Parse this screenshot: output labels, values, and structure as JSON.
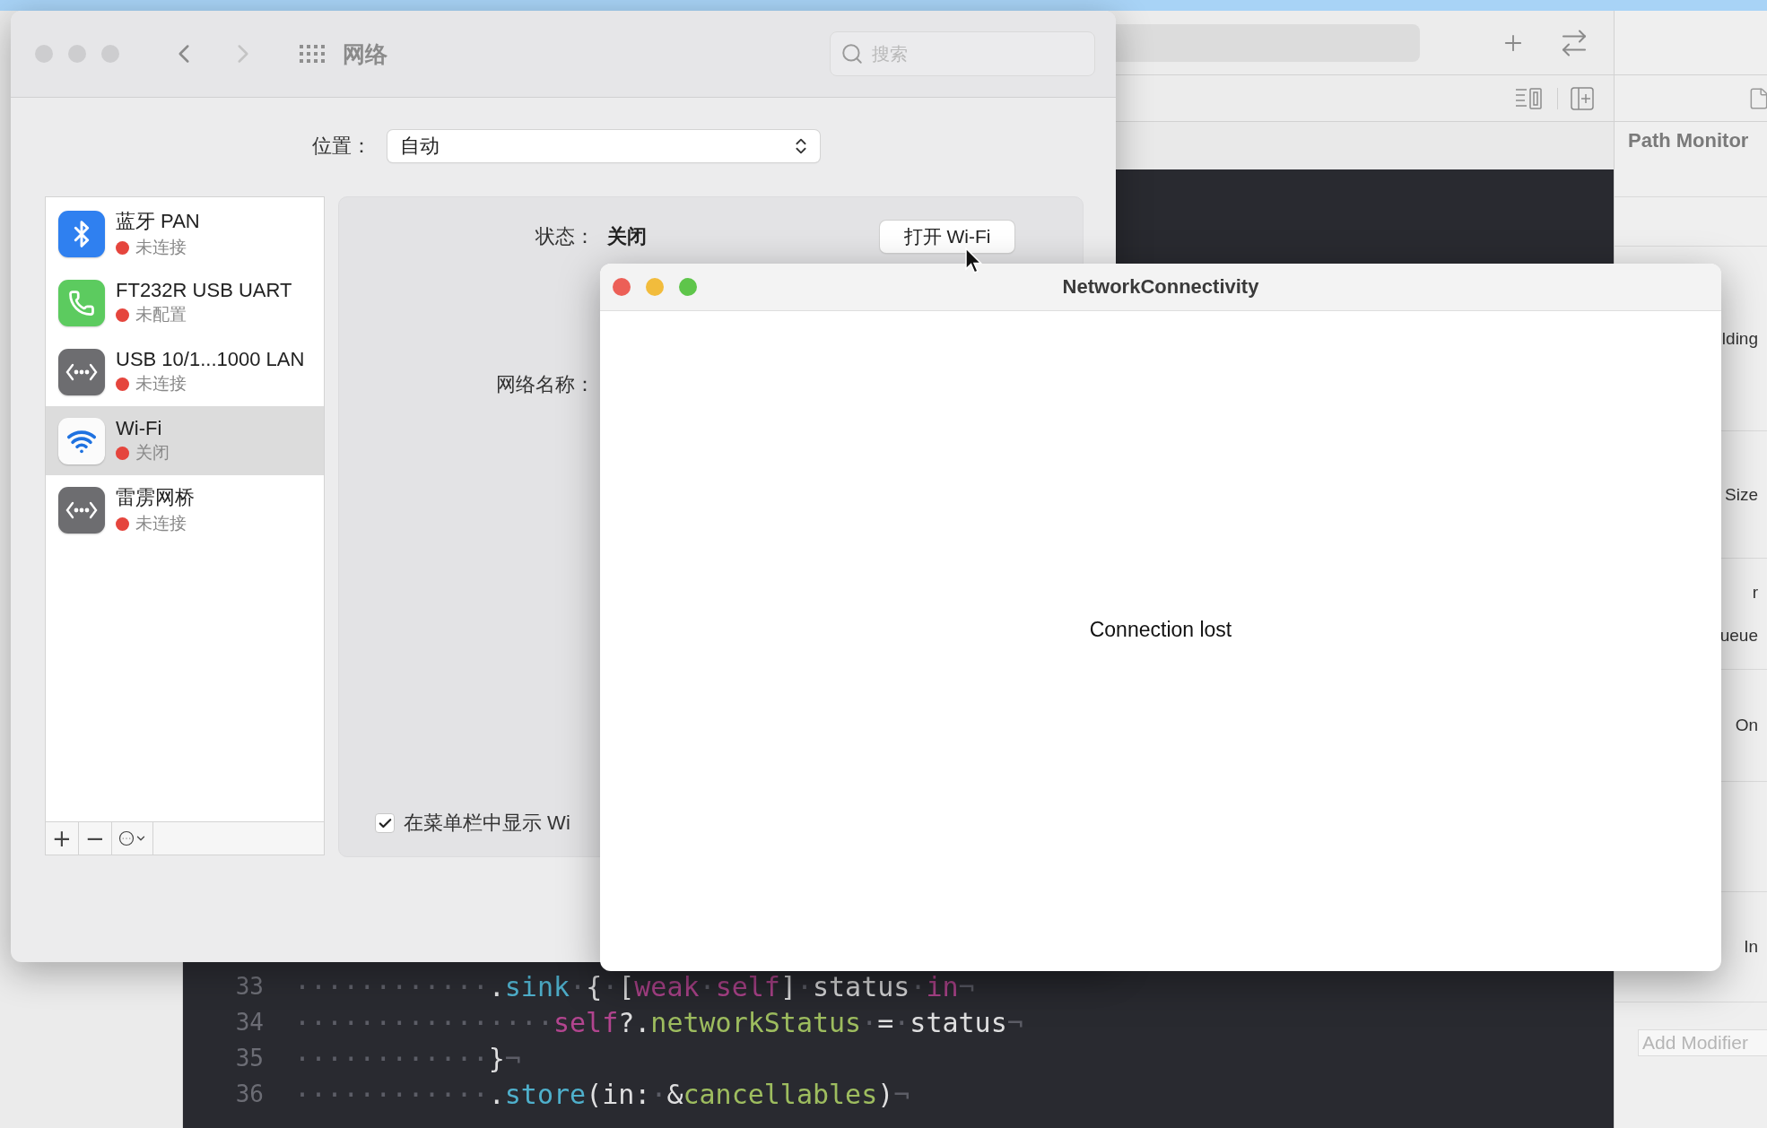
{
  "xcode": {
    "inspector": {
      "title": "Path Monitor",
      "rows": [
        {
          "kind": "blank"
        },
        {
          "kind": "labels",
          "labels": [
            "lding"
          ]
        },
        {
          "kind": "labels",
          "labels": [
            "Size"
          ]
        },
        {
          "kind": "labels",
          "labels": [
            "r",
            "ueue"
          ]
        },
        {
          "kind": "labels",
          "labels": [
            "On"
          ]
        },
        {
          "kind": "blank"
        },
        {
          "kind": "labels",
          "labels": [
            "In"
          ]
        }
      ],
      "add_modifier": {
        "placeholder": "Add Modifier"
      }
    },
    "code_lines": [
      {
        "number": "33",
        "tokens": [
          {
            "kind": "ws",
            "text": "············"
          },
          {
            "kind": "plain",
            "text": "."
          },
          {
            "kind": "method",
            "text": "sink"
          },
          {
            "kind": "ws",
            "text": "·"
          },
          {
            "kind": "plain",
            "text": "{"
          },
          {
            "kind": "ws",
            "text": "·"
          },
          {
            "kind": "plain",
            "text": "["
          },
          {
            "kind": "keyword",
            "text": "weak"
          },
          {
            "kind": "ws",
            "text": "·"
          },
          {
            "kind": "keyword",
            "text": "self"
          },
          {
            "kind": "plain",
            "text": "]"
          },
          {
            "kind": "ws",
            "text": "·"
          },
          {
            "kind": "plain",
            "text": "status"
          },
          {
            "kind": "ws",
            "text": "·"
          },
          {
            "kind": "keyword",
            "text": "in"
          },
          {
            "kind": "ws",
            "text": "¬"
          }
        ]
      },
      {
        "number": "34",
        "tokens": [
          {
            "kind": "ws",
            "text": "················"
          },
          {
            "kind": "keyword",
            "text": "self"
          },
          {
            "kind": "plain",
            "text": "?."
          },
          {
            "kind": "property",
            "text": "networkStatus"
          },
          {
            "kind": "ws",
            "text": "·"
          },
          {
            "kind": "plain",
            "text": "="
          },
          {
            "kind": "ws",
            "text": "·"
          },
          {
            "kind": "plain",
            "text": "status"
          },
          {
            "kind": "ws",
            "text": "¬"
          }
        ]
      },
      {
        "number": "35",
        "tokens": [
          {
            "kind": "ws",
            "text": "············"
          },
          {
            "kind": "plain",
            "text": "}"
          },
          {
            "kind": "ws",
            "text": "¬"
          }
        ]
      },
      {
        "number": "36",
        "tokens": [
          {
            "kind": "ws",
            "text": "············"
          },
          {
            "kind": "plain",
            "text": "."
          },
          {
            "kind": "method",
            "text": "store"
          },
          {
            "kind": "plain",
            "text": "(in:"
          },
          {
            "kind": "ws",
            "text": "·"
          },
          {
            "kind": "plain",
            "text": "&"
          },
          {
            "kind": "property",
            "text": "cancellables"
          },
          {
            "kind": "plain",
            "text": ")"
          },
          {
            "kind": "ws",
            "text": "¬"
          }
        ]
      }
    ]
  },
  "prefs_window": {
    "title": "网络",
    "search": {
      "placeholder": "搜索"
    },
    "location": {
      "label": "位置：",
      "value": "自动"
    },
    "services": [
      {
        "kind": "bluetooth",
        "name": "蓝牙 PAN",
        "status": "未连接",
        "color": "#e5453d",
        "selected": false
      },
      {
        "kind": "modem",
        "name": "FT232R USB UART",
        "status": "未配置",
        "color": "#e5453d",
        "selected": false
      },
      {
        "kind": "ethernet",
        "name": "USB 10/1...1000 LAN",
        "status": "未连接",
        "color": "#e5453d",
        "selected": false
      },
      {
        "kind": "wifi",
        "name": "Wi-Fi",
        "status": "关闭",
        "color": "#e5453d",
        "selected": true
      },
      {
        "kind": "ethernet",
        "name": "雷雳网桥",
        "status": "未连接",
        "color": "#e5453d",
        "selected": false
      }
    ],
    "list_buttons": [
      {
        "kind": "add",
        "label": "+"
      },
      {
        "kind": "remove",
        "label": "−"
      },
      {
        "kind": "action"
      }
    ],
    "detail": {
      "status_label": "状态：",
      "status_value": "关闭",
      "toggle_button": "打开 Wi-Fi",
      "network_name_label": "网络名称：",
      "show_in_menu_bar": {
        "label": "在菜单栏中显示 Wi",
        "checked": true
      }
    }
  },
  "front_window": {
    "title": "NetworkConnectivity",
    "message": "Connection lost"
  }
}
